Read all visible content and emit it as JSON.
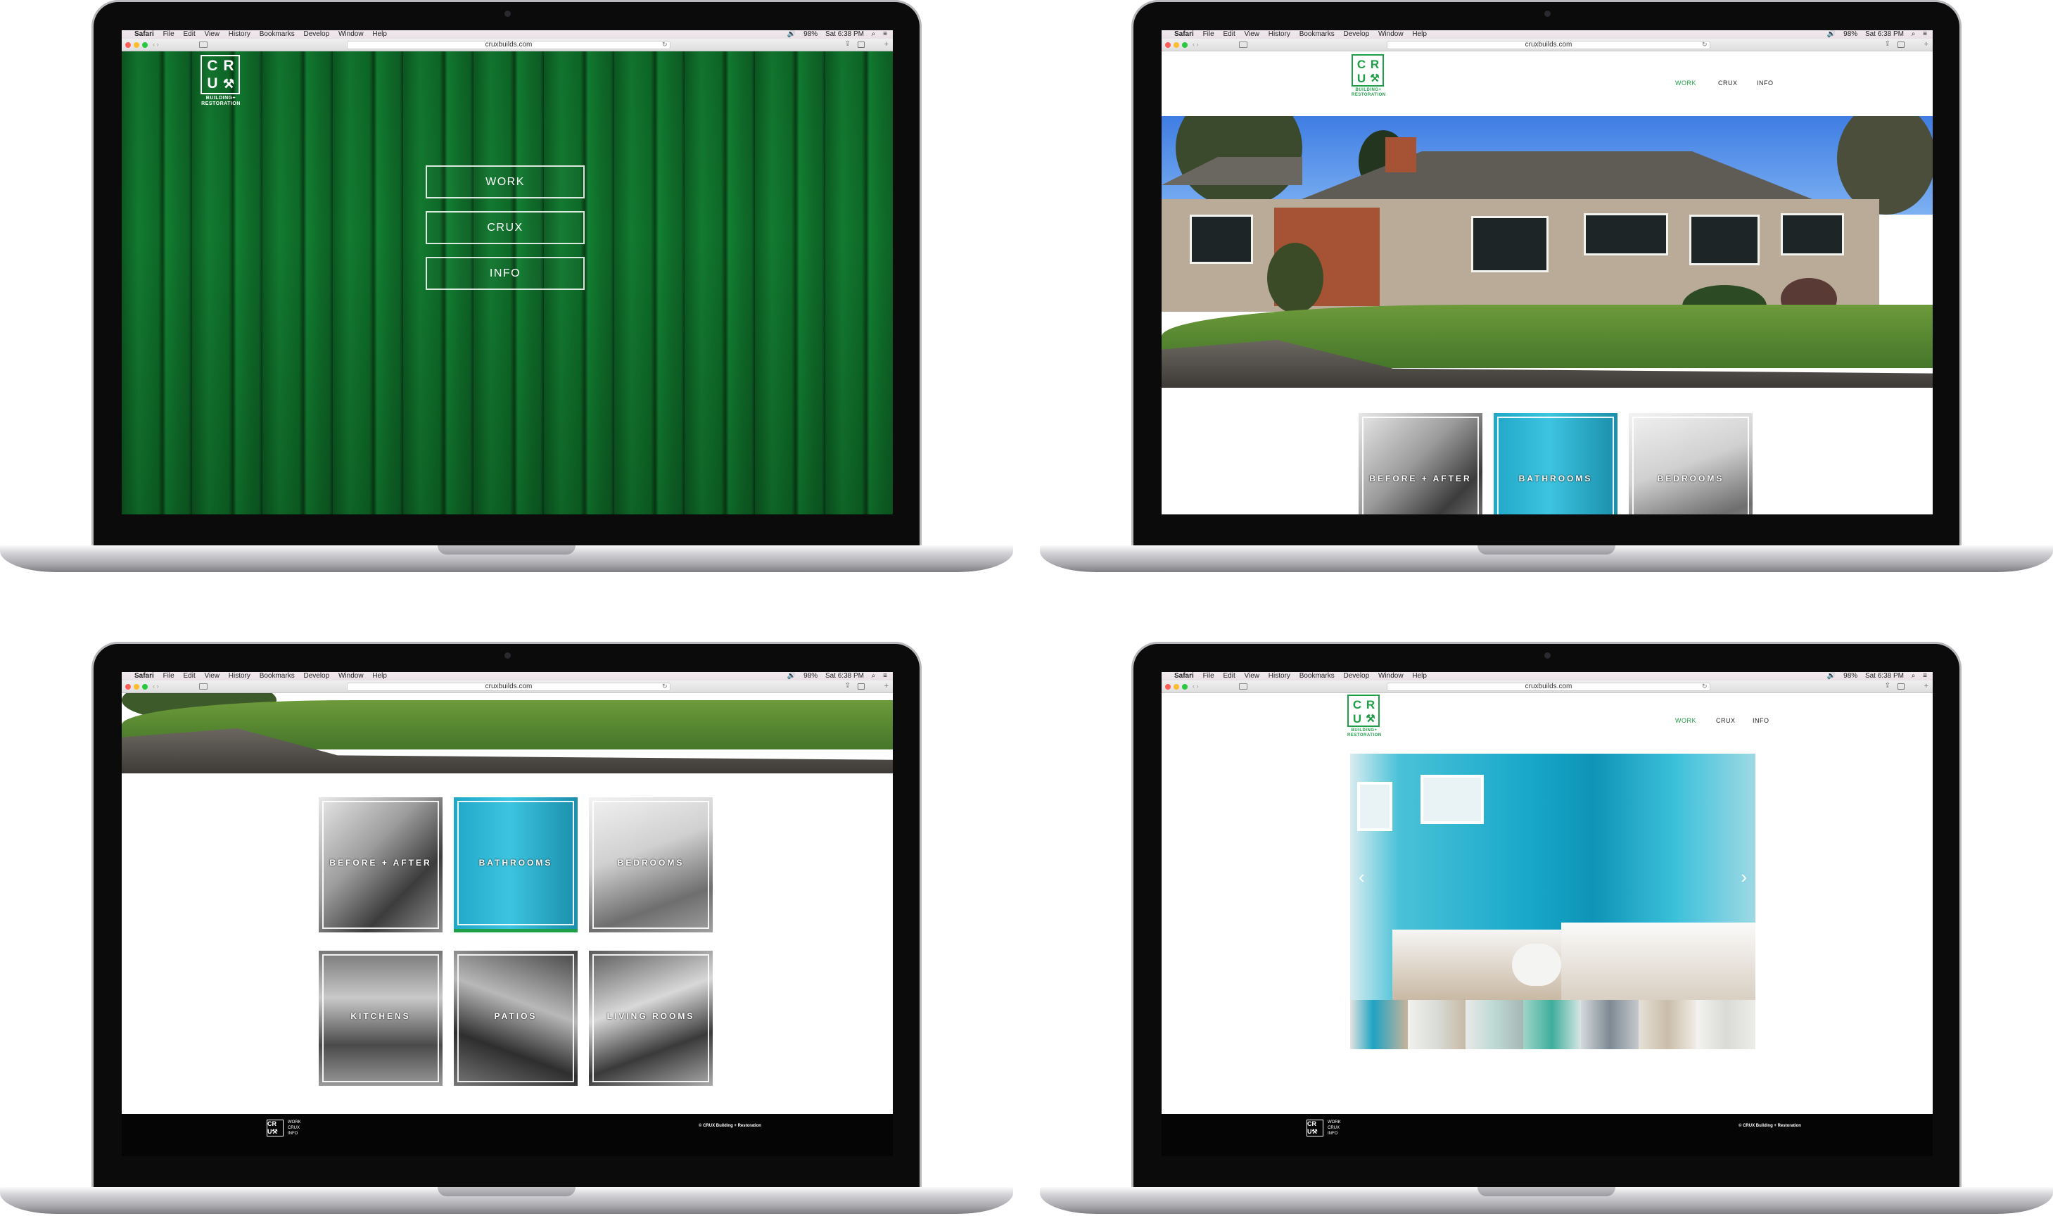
{
  "browser": {
    "apple_glyph": "",
    "app_name": "Safari",
    "menus": [
      "File",
      "Edit",
      "View",
      "History",
      "Bookmarks",
      "Develop",
      "Window",
      "Help"
    ],
    "battery": "98%",
    "clock": "Sat 6:38 PM",
    "url": "cruxbuilds.com"
  },
  "logo": {
    "letters": [
      "C",
      "R",
      "U",
      "⚒"
    ],
    "tagline_1": "BUILDING+",
    "tagline_2": "RESTORATION"
  },
  "splash_menu": [
    "WORK",
    "CRUX",
    "INFO"
  ],
  "nav": {
    "items": [
      "WORK",
      "CRUX",
      "INFO"
    ],
    "active": "WORK"
  },
  "categories": [
    "BEFORE + AFTER",
    "BATHROOMS",
    "BEDROOMS",
    "KITCHENS",
    "PATIOS",
    "LIVING ROOMS"
  ],
  "footer": {
    "links": [
      "WORK",
      "CRUX",
      "INFO"
    ],
    "copyright": "© CRUX Building + Restoration"
  },
  "slideshow": {
    "prev": "‹",
    "next": "›"
  },
  "colors": {
    "brand_green": "#1e9e47",
    "wood_green": "#0f6c29",
    "teal": "#16a7c9",
    "footer_bg": "#050505"
  }
}
